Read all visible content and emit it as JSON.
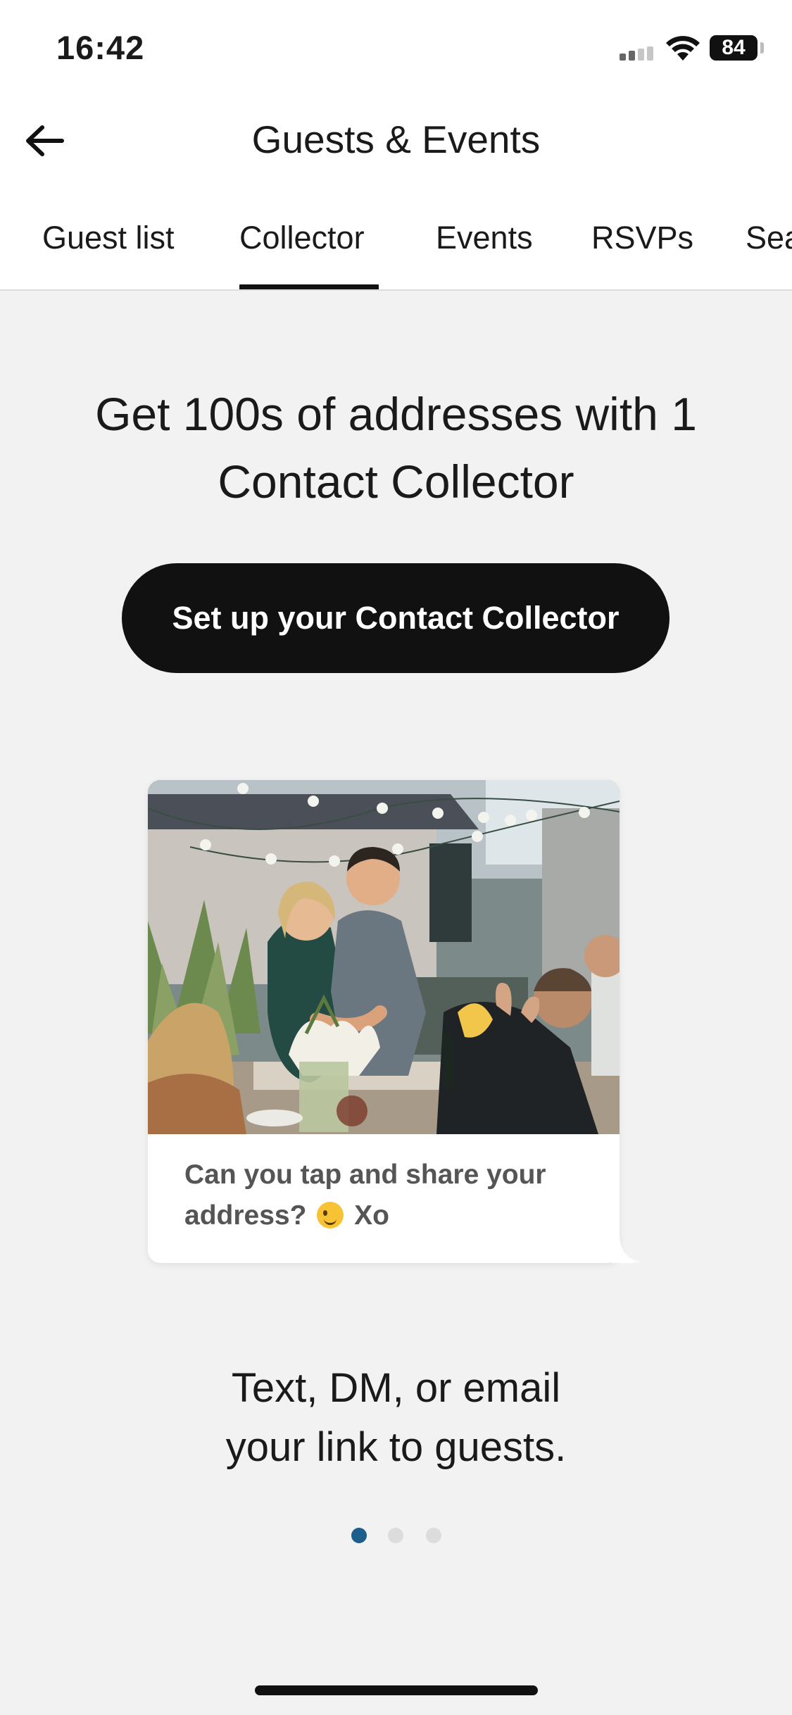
{
  "status_bar": {
    "time": "16:42",
    "battery": "84"
  },
  "header": {
    "title": "Guests & Events"
  },
  "tabs": [
    {
      "label": "Guest list"
    },
    {
      "label": "Collector",
      "active": true
    },
    {
      "label": "Events"
    },
    {
      "label": "RSVPs"
    },
    {
      "label": "Seating"
    }
  ],
  "main": {
    "headline": "Get 100s of addresses with 1 Contact Collector",
    "cta_label": "Set up your Contact Collector",
    "card": {
      "message_before_emoji": "Can you tap and share your address?",
      "message_after_emoji": "Xo"
    },
    "caption_line1": "Text, DM, or email",
    "caption_line2": "your link to guests.",
    "carousel": {
      "total": 3,
      "active": 1
    }
  },
  "colors": {
    "accent_dot": "#1c5f8a",
    "cta_bg": "#111111",
    "background": "#f2f2f2"
  }
}
